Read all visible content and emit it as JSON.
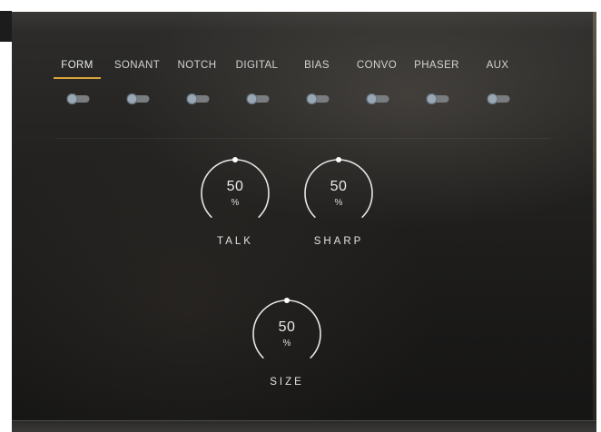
{
  "tabs": [
    {
      "label": "FORM",
      "active": true
    },
    {
      "label": "SONANT",
      "active": false
    },
    {
      "label": "NOTCH",
      "active": false
    },
    {
      "label": "DIGITAL",
      "active": false
    },
    {
      "label": "BIAS",
      "active": false
    },
    {
      "label": "CONVO",
      "active": false
    },
    {
      "label": "PHASER",
      "active": false
    },
    {
      "label": "AUX",
      "active": false
    }
  ],
  "toggles": [
    {
      "state": "off"
    },
    {
      "state": "off"
    },
    {
      "state": "off"
    },
    {
      "state": "off"
    },
    {
      "state": "off"
    },
    {
      "state": "off"
    },
    {
      "state": "off"
    },
    {
      "state": "off"
    }
  ],
  "knobs": {
    "talk": {
      "value": "50",
      "unit": "%",
      "label": "TALK",
      "level": 0.5
    },
    "sharp": {
      "value": "50",
      "unit": "%",
      "label": "SHARP",
      "level": 0.5
    },
    "size": {
      "value": "50",
      "unit": "%",
      "label": "SIZE",
      "level": 0.5
    }
  },
  "colors": {
    "accent": "#d9a43a",
    "toggle_knob": "#9aa7b4",
    "toggle_track": "#7a7d80",
    "panel_background": "#1b1a19"
  }
}
